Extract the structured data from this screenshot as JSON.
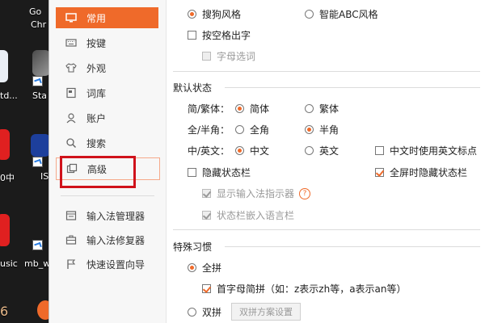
{
  "desktop": {
    "labels": [
      "Go",
      "Chr",
      "td...",
      "Sta",
      "0中",
      "IS",
      "usic",
      "mb_w",
      "6"
    ]
  },
  "sidebar": {
    "items": [
      {
        "label": "常用",
        "icon": "monitor-icon"
      },
      {
        "label": "按键",
        "icon": "keyboard-icon"
      },
      {
        "label": "外观",
        "icon": "shirt-icon"
      },
      {
        "label": "词库",
        "icon": "book-icon"
      },
      {
        "label": "账户",
        "icon": "user-icon"
      },
      {
        "label": "搜索",
        "icon": "search-icon"
      },
      {
        "label": "高级",
        "icon": "layers-icon"
      }
    ],
    "tools": [
      {
        "label": "输入法管理器",
        "icon": "manager-icon"
      },
      {
        "label": "输入法修复器",
        "icon": "toolbox-icon"
      },
      {
        "label": "快速设置向导",
        "icon": "flag-icon"
      }
    ]
  },
  "style": {
    "sogou": "搜狗风格",
    "abc": "智能ABC风格",
    "space_output": "按空格出字",
    "letter_select": "字母选词"
  },
  "default_state": {
    "title": "默认状态",
    "jianfan_label": "简/繁体：",
    "jianti": "简体",
    "fanti": "繁体",
    "quanban_label": "全/半角：",
    "quanjiao": "全角",
    "banjiao": "半角",
    "zhongying_label": "中/英文：",
    "zhongwen": "中文",
    "yingwen": "英文",
    "en_punct": "中文时使用英文标点",
    "hide_status": "隐藏状态栏",
    "fullscreen_hide": "全屏时隐藏状态栏",
    "show_indicator": "显示输入法指示器",
    "embed_lang": "状态栏嵌入语言栏",
    "help": "?"
  },
  "special": {
    "title": "特殊习惯",
    "quanpin": "全拼",
    "initial_jianpin": "首字母简拼（如：z表示zh等，a表示an等）",
    "shuangpin": "双拼",
    "shuangpin_btn": "双拼方案设置"
  },
  "colors": {
    "accent": "#ef6a2a",
    "annotation": "#d0121b"
  }
}
